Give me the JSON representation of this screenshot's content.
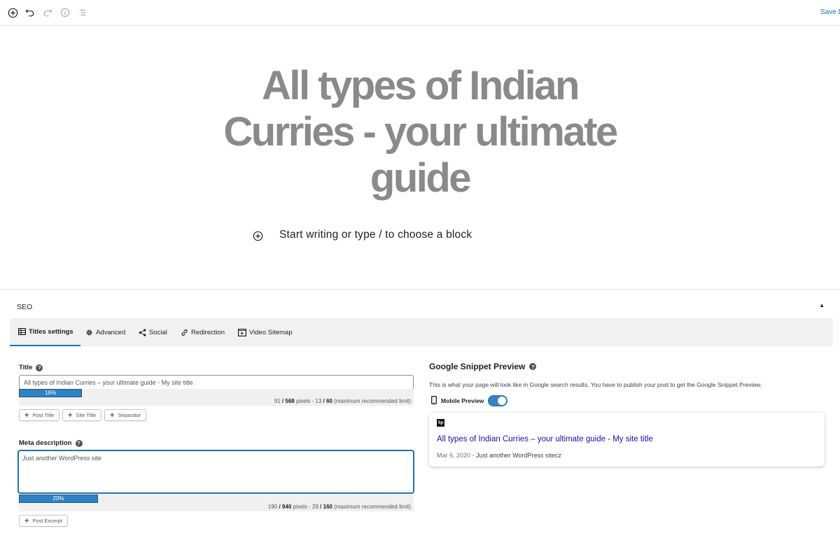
{
  "toolbar": {
    "save_draft_label": "Save Draft"
  },
  "editor": {
    "post_title": "All types of Indian Curries - your ultimate guide",
    "block_placeholder": "Start writing or type / to choose a block"
  },
  "seo": {
    "header": "SEO",
    "toggle_glyph": "▲",
    "tabs": [
      {
        "label": "Titles settings",
        "icon": "table-icon"
      },
      {
        "label": "Advanced",
        "icon": "gear-icon"
      },
      {
        "label": "Social",
        "icon": "share-icon"
      },
      {
        "label": "Redirection",
        "icon": "link-icon"
      },
      {
        "label": "Video Sitemap",
        "icon": "video-icon"
      }
    ],
    "title_field": {
      "label": "Title",
      "value": "All types of Indian Curries – your ultimate guide - My site title",
      "progress_percent": 16,
      "progress_label": "16%",
      "pixels": "91",
      "pixels_limit": "/ 568",
      "pixels_suffix": " pixels - 13 ",
      "chars_limit": "/ 60",
      "limit_note": " (maximum recommended limit)",
      "tags": [
        "Post Title",
        "Site Title",
        "Separator"
      ]
    },
    "meta_field": {
      "label": "Meta description",
      "value": "Just another WordPress site",
      "progress_percent": 20,
      "progress_label": "20%",
      "pixels": "190",
      "pixels_limit": "/ 940",
      "pixels_suffix": " pixels - 29 ",
      "chars_limit": "/ 160",
      "limit_note": " (maximum recommended limit)",
      "tags": [
        "Post Excerpt"
      ]
    },
    "snippet": {
      "heading": "Google Snippet Preview",
      "description": "This is what your page will look like in Google search results. You have to publish your post to get the Google Snippet Preview.",
      "mobile_preview_label": "Mobile Preview",
      "mobile_preview_on": true,
      "favicon_text": "Sp",
      "link_title": "All types of Indian Curries – your ultimate guide - My site title",
      "date": "Mar 6, 2020 - ",
      "text": "Just another WordPress sitecz"
    }
  },
  "colors": {
    "accent": "#2271b1",
    "progress": "#2f82c2",
    "title_gray": "#8a8a8a",
    "link": "#1a0dab"
  }
}
